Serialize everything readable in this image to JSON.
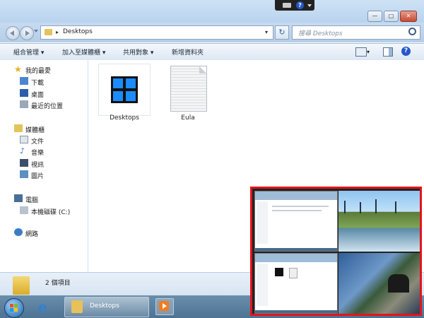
{
  "window": {
    "address_path": "Desktops",
    "search_placeholder": "搜尋 Desktops",
    "controls": {
      "minimize": "—",
      "maximize": "□",
      "close": "✕"
    }
  },
  "toolbar": {
    "organize": "組合管理 ▾",
    "add_to_library": "加入至媒體櫃 ▾",
    "share_with": "共用對象 ▾",
    "new_folder": "新增資料夾"
  },
  "sidebar": {
    "favorites": "我的最愛",
    "downloads": "下載",
    "desktop": "桌面",
    "recent": "最近的位置",
    "libraries": "媒體櫃",
    "documents": "文件",
    "music": "音樂",
    "videos": "視訊",
    "pictures": "圖片",
    "computer": "電腦",
    "local_disk": "本機磁碟 (C:)",
    "network": "網路"
  },
  "files": [
    {
      "name": "Desktops",
      "icon": "app-grid-icon"
    },
    {
      "name": "Eula",
      "icon": "text-document-icon"
    }
  ],
  "status": {
    "count": "2 個項目"
  },
  "taskbar": {
    "active_window": "Desktops"
  },
  "colors": {
    "highlight": "#e3141b",
    "accent": "#1c6fd8"
  }
}
